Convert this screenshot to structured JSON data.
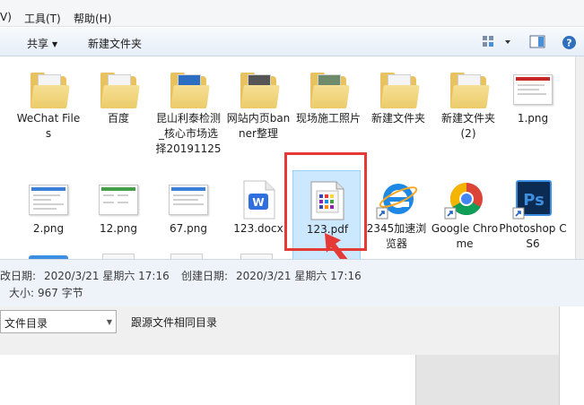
{
  "menu": {
    "partial_left": "V)",
    "tools": "工具(T)",
    "help": "帮助(H)"
  },
  "toolbar": {
    "share": "共享",
    "new_folder": "新建文件夹"
  },
  "files": [
    {
      "name": "WeChat Files",
      "type": "folder"
    },
    {
      "name": "百度",
      "type": "folder"
    },
    {
      "name": "昆山利泰检测_核心市场选择20191125",
      "type": "folder"
    },
    {
      "name": "网站内页banner整理",
      "type": "folder"
    },
    {
      "name": "现场施工照片",
      "type": "folder"
    },
    {
      "name": "新建文件夹",
      "type": "folder"
    },
    {
      "name": "新建文件夹 (2)",
      "type": "folder"
    },
    {
      "name": "1.png",
      "type": "image"
    },
    {
      "name": "2.png",
      "type": "image"
    },
    {
      "name": "12.png",
      "type": "image"
    },
    {
      "name": "67.png",
      "type": "image"
    },
    {
      "name": "123.docx",
      "type": "docx"
    },
    {
      "name": "123.pdf",
      "type": "pdf"
    },
    {
      "name": "2345加速浏览器",
      "type": "ie-shortcut"
    },
    {
      "name": "Google Chrome",
      "type": "chrome-shortcut"
    },
    {
      "name": "Photoshop CS6",
      "type": "ps-shortcut"
    }
  ],
  "status": {
    "modified_label": "改日期:",
    "modified_value": "2020/3/21 星期六 17:16",
    "created_label": "创建日期:",
    "created_value": "2020/3/21 星期六 17:16",
    "size_label": "大小:",
    "size_value": "967 字节"
  },
  "bottom": {
    "combo_value": "文件目录",
    "option_text": "跟源文件相同目录"
  },
  "colors": {
    "accent": "#3c7fd6",
    "selection": "#cce8ff",
    "annotation": "#e53935"
  }
}
